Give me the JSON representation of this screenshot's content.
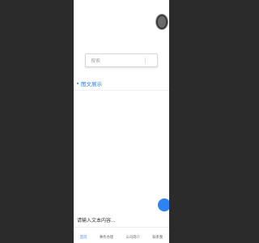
{
  "search": {
    "placeholder": "搜索"
  },
  "section": {
    "title": "图文展示"
  },
  "message": {
    "placeholder": "请输入文本内容..."
  },
  "nav": {
    "items": [
      {
        "label": "首页"
      },
      {
        "label": "事务办理"
      },
      {
        "label": "公司简介"
      },
      {
        "label": "联系我"
      }
    ]
  },
  "colors": {
    "accent": "#2f7ef0",
    "fab": "#2f82f1",
    "background": "#2b2b2b"
  }
}
